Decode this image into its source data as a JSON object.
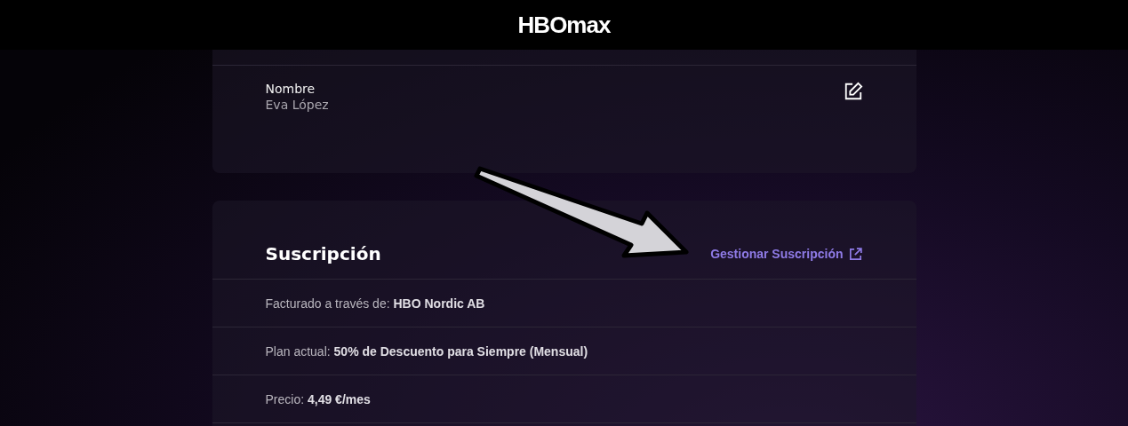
{
  "header": {
    "logo": "HBOmax"
  },
  "profile_card": {
    "field_label": "Nombre",
    "field_value": "Eva López"
  },
  "subscription_card": {
    "title": "Suscripción",
    "manage_link": "Gestionar Suscripción",
    "rows": [
      {
        "text": "Facturado a través de: **HBO Nordic AB**"
      },
      {
        "text": "Plan actual: **50% de Descuento para Siempre (Mensual)**"
      },
      {
        "text": "Precio: **4,49 €/mes**"
      }
    ]
  }
}
